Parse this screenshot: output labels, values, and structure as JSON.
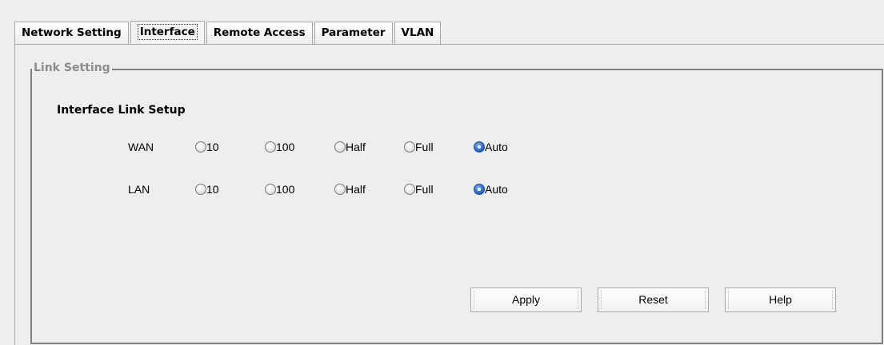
{
  "tabs": [
    {
      "label": "Network Setting",
      "active": false
    },
    {
      "label": "Interface",
      "active": true
    },
    {
      "label": "Remote Access",
      "active": false
    },
    {
      "label": "Parameter",
      "active": false
    },
    {
      "label": "VLAN",
      "active": false
    }
  ],
  "group_title": "Link Setting",
  "section_heading": "Interface Link Setup",
  "rows": [
    {
      "label": "WAN",
      "options": [
        "10",
        "100",
        "Half",
        "Full",
        "Auto"
      ],
      "selected": "Auto"
    },
    {
      "label": "LAN",
      "options": [
        "10",
        "100",
        "Half",
        "Full",
        "Auto"
      ],
      "selected": "Auto"
    }
  ],
  "buttons": {
    "apply": "Apply",
    "reset": "Reset",
    "help": "Help"
  },
  "colors": {
    "background": "#eeeeee",
    "radio_selected": "#2e6fd6",
    "group_title": "#8c8c8c"
  }
}
